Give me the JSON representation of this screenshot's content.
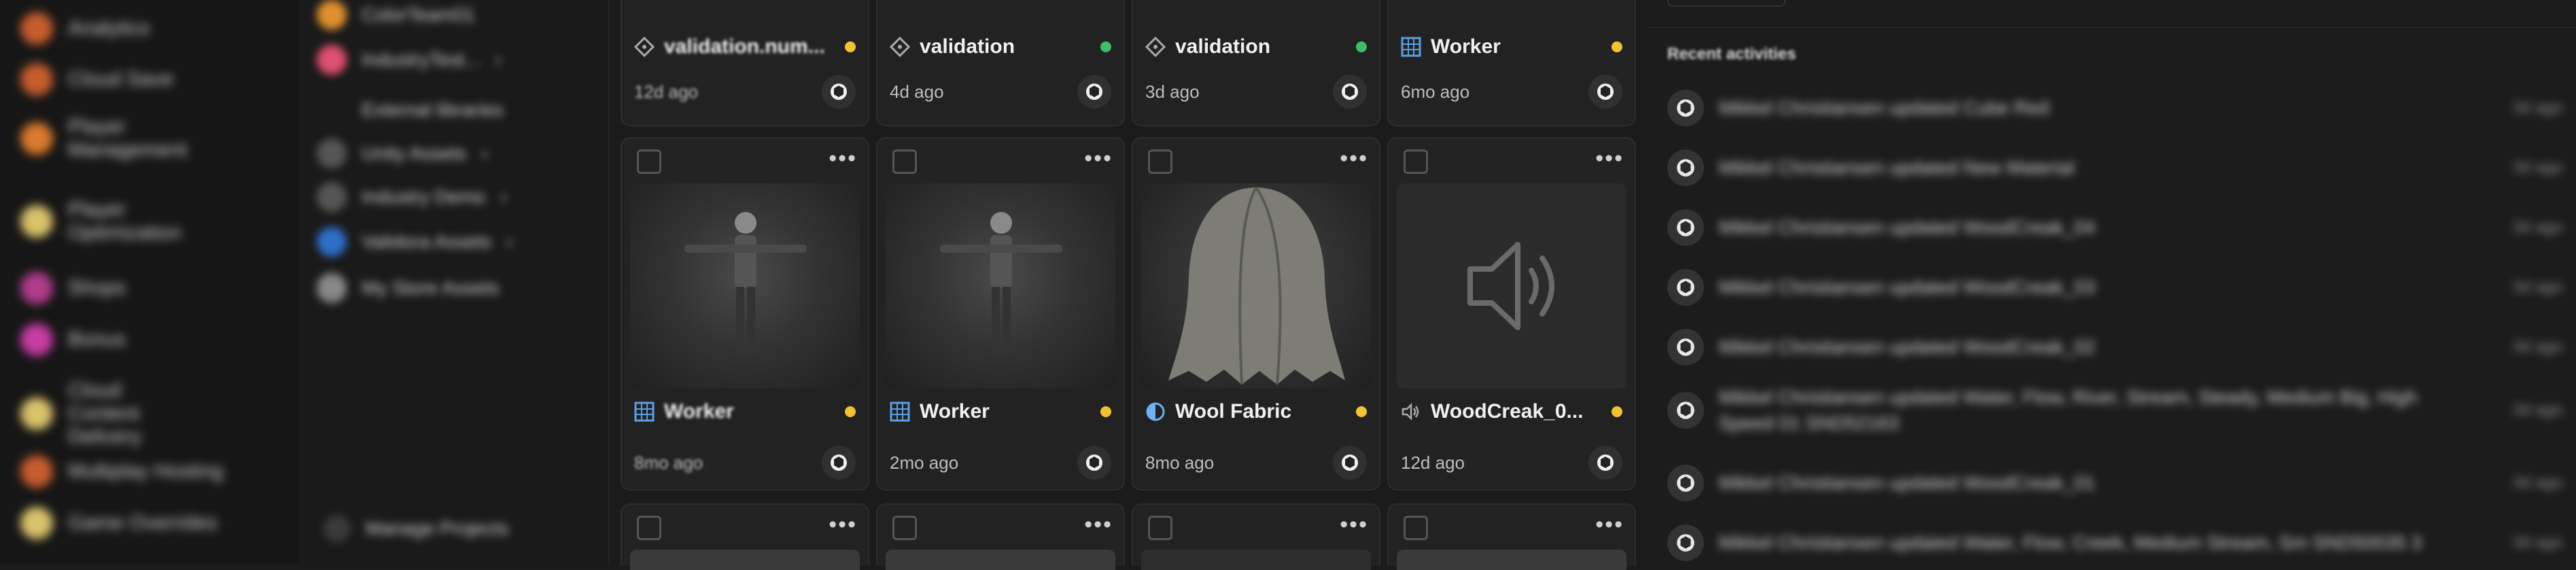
{
  "sidebar": {
    "items": [
      {
        "label": "Analytics",
        "color": "#c65d2e"
      },
      {
        "label": "Cloud Save",
        "color": "#c65d2e"
      },
      {
        "label": "Player Management",
        "color": "#d97a2e"
      },
      {
        "label": "Player Optimization",
        "color": "#d9c36b"
      },
      {
        "label": "Shops",
        "color": "#b03c8a"
      },
      {
        "label": "Bonus",
        "color": "#c83ca3"
      },
      {
        "label": "Cloud Content Delivery",
        "color": "#d9c36b"
      },
      {
        "label": "Multiplay Hosting",
        "color": "#c65d2e"
      },
      {
        "label": "Game Overrides",
        "color": "#d9c36b"
      }
    ]
  },
  "projects": {
    "items": [
      {
        "label": "ColorTeam01",
        "color": "#e0902e",
        "chevron": false
      },
      {
        "label": "IndustryTest...",
        "color": "#e05070",
        "chevron": true
      },
      {
        "label": "External libraries",
        "color": "#555555",
        "chevron": false
      },
      {
        "label": "Unity Assets",
        "color": "#555555",
        "chevron": true
      },
      {
        "label": "Industry Demo",
        "color": "#555555",
        "chevron": true
      },
      {
        "label": "Validora Assets",
        "color": "#2e6fc9",
        "chevron": true
      },
      {
        "label": "My Store Assets",
        "color": "#888888",
        "chevron": false
      }
    ],
    "manage_label": "Manage Projects"
  },
  "top_row": [
    {
      "title": "validation.num...",
      "date": "12d ago",
      "status_color": "#f2c230",
      "icon": "diamond-icon"
    },
    {
      "title": "validation",
      "date": "4d ago",
      "status_color": "#3cbf6a",
      "icon": "diamond-icon"
    },
    {
      "title": "validation",
      "date": "3d ago",
      "status_color": "#3cbf6a",
      "icon": "diamond-icon"
    },
    {
      "title": "Worker",
      "date": "6mo ago",
      "status_color": "#f2c230",
      "icon": "grid-icon"
    }
  ],
  "cards": [
    {
      "title": "Worker",
      "date": "8mo ago",
      "status_color": "#f2c230",
      "icon": "grid-icon",
      "thumb": "character"
    },
    {
      "title": "Worker",
      "date": "2mo ago",
      "status_color": "#f2c230",
      "icon": "grid-icon",
      "thumb": "character"
    },
    {
      "title": "Wool Fabric",
      "date": "8mo ago",
      "status_color": "#f2c230",
      "icon": "material-icon",
      "thumb": "fabric"
    },
    {
      "title": "WoodCreak_0...",
      "date": "12d ago",
      "status_color": "#f2c230",
      "icon": "audio-icon",
      "thumb": "audio"
    }
  ],
  "card_more_label": "•••",
  "activity": {
    "section_title": "Recent activities",
    "items": [
      {
        "text": "Mikkel Christiansen updated Cube Red",
        "time": "3d ago"
      },
      {
        "text": "Mikkel Christiansen updated New Material",
        "time": "3d ago"
      },
      {
        "text": "Mikkel Christiansen updated WoodCreak_04",
        "time": "3d ago"
      },
      {
        "text": "Mikkel Christiansen updated WoodCreak_03",
        "time": "3d ago"
      },
      {
        "text": "Mikkel Christiansen updated WoodCreak_02",
        "time": "3d ago"
      },
      {
        "text": "Mikkel Christiansen updated Water, Flow, River, Stream, Steady, Medium Big, High Speed 01 SND52163",
        "time": "3d ago"
      },
      {
        "text": "Mikkel Christiansen updated WoodCreak_01",
        "time": "3d ago"
      },
      {
        "text": "Mikkel Christiansen updated Water, Flow, Creek, Medium Stream, Sm SND50035 3",
        "time": "3d ago"
      }
    ]
  }
}
